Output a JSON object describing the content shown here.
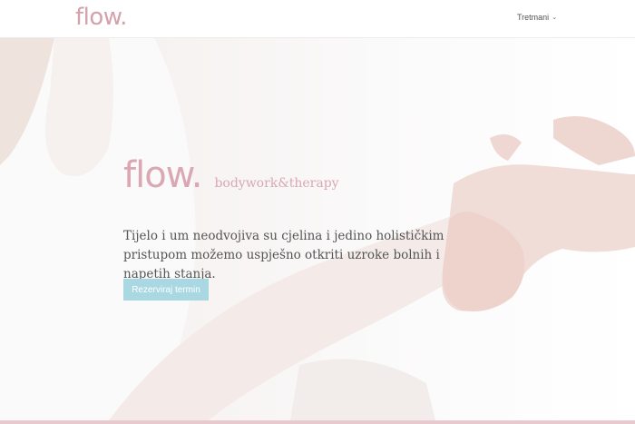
{
  "header": {
    "logo": "flow.",
    "nav": {
      "treatments_label": "Tretmani"
    }
  },
  "hero": {
    "brand_logo": "flow.",
    "brand_subtitle": "bodywork&therapy",
    "tagline": "Tijelo i um neodvojiva su cjelina i jedino holističkim pristupom možemo uspješno otkriti uzroke bolnih i napetih stanja.",
    "cta_label": "Rezerviraj termin"
  },
  "colors": {
    "brand_pink": "#dba7b3",
    "cta_blue": "#a9d8e3",
    "accent_bar": "#e8c9cd"
  },
  "icons": {
    "nav_dropdown": "chevron-down-icon"
  }
}
